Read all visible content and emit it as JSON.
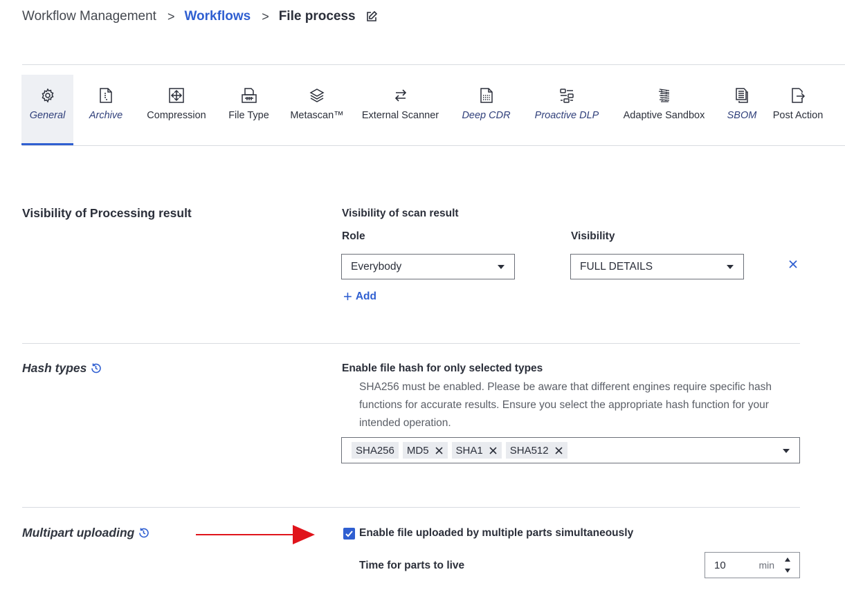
{
  "breadcrumb": {
    "root": "Workflow Management",
    "separator": ">",
    "parent": "Workflows",
    "current": "File process"
  },
  "tabs": [
    {
      "label": "General",
      "icon": "gear-icon",
      "italic": true,
      "active": true
    },
    {
      "label": "Archive",
      "icon": "archive-file-icon",
      "italic": true,
      "active": false
    },
    {
      "label": "Compression",
      "icon": "compression-icon",
      "italic": false,
      "active": false
    },
    {
      "label": "File Type",
      "icon": "file-type-icon",
      "italic": false,
      "active": false
    },
    {
      "label": "Metascan™",
      "icon": "layers-icon",
      "italic": false,
      "active": false
    },
    {
      "label": "External Scanner",
      "icon": "swap-arrows-icon",
      "italic": false,
      "active": false
    },
    {
      "label": "Deep CDR",
      "icon": "deep-cdr-icon",
      "italic": true,
      "active": false
    },
    {
      "label": "Proactive DLP",
      "icon": "dlp-icon",
      "italic": true,
      "active": false
    },
    {
      "label": "Adaptive Sandbox",
      "icon": "sandbox-icon",
      "italic": false,
      "active": false
    },
    {
      "label": "SBOM",
      "icon": "sbom-icon",
      "italic": true,
      "active": false
    },
    {
      "label": "Post Action",
      "icon": "post-action-icon",
      "italic": false,
      "active": false
    }
  ],
  "visibility_section": {
    "title": "Visibility of Processing result",
    "subtitle": "Visibility of scan result",
    "role_label": "Role",
    "visibility_label": "Visibility",
    "role_value": "Everybody",
    "visibility_value": "FULL DETAILS",
    "add_label": "Add"
  },
  "hash_section": {
    "title": "Hash types",
    "subtitle": "Enable file hash for only selected types",
    "help": "SHA256 must be enabled. Please be aware that different engines require specific hash functions for accurate results. Ensure you select the appropriate hash function for your intended operation.",
    "chips": [
      {
        "label": "SHA256",
        "removable": false
      },
      {
        "label": "MD5",
        "removable": true
      },
      {
        "label": "SHA1",
        "removable": true
      },
      {
        "label": "SHA512",
        "removable": true
      }
    ]
  },
  "multipart_section": {
    "title": "Multipart uploading",
    "checkbox_label": "Enable file uploaded by multiple parts simultaneously",
    "checked": true,
    "ttl_label": "Time for parts to live",
    "ttl_value": "10",
    "ttl_unit": "min"
  },
  "colors": {
    "accent": "#2f5fd1",
    "annotation_arrow": "#e0141b",
    "divider": "#d8dbe0"
  }
}
